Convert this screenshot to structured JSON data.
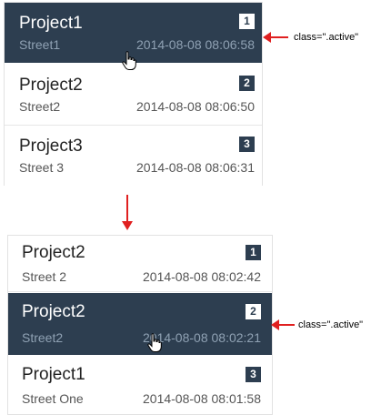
{
  "before_list": {
    "items": [
      {
        "title": "Project1",
        "street": "Street1",
        "date": "2014-08-08 08:06:58",
        "badge": "1"
      },
      {
        "title": "Project2",
        "street": "Street2",
        "date": "2014-08-08 08:06:50",
        "badge": "2"
      },
      {
        "title": "Project3",
        "street": "Street 3",
        "date": "2014-08-08 08:06:31",
        "badge": "3"
      }
    ],
    "active_index": 0
  },
  "after_list": {
    "items": [
      {
        "title": "Project2",
        "street": "Street 2",
        "date": "2014-08-08 08:02:42",
        "badge": "1"
      },
      {
        "title": "Project2",
        "street": "Street2",
        "date": "2014-08-08 08:02:21",
        "badge": "2"
      },
      {
        "title": "Project1",
        "street": "Street One",
        "date": "2014-08-08 08:01:58",
        "badge": "3"
      }
    ],
    "active_index": 1
  },
  "annotations": {
    "top_note": "class=\".active\"",
    "bottom_note": "class=\".active\""
  },
  "colors": {
    "active_bg": "#2d3e50",
    "active_subtext": "#8fa1b3",
    "arrow": "#e02020"
  },
  "icons": {
    "cursor": "hand-pointer-icon",
    "transition": "arrow-down-icon",
    "pointer_arrow": "arrow-left-icon"
  }
}
